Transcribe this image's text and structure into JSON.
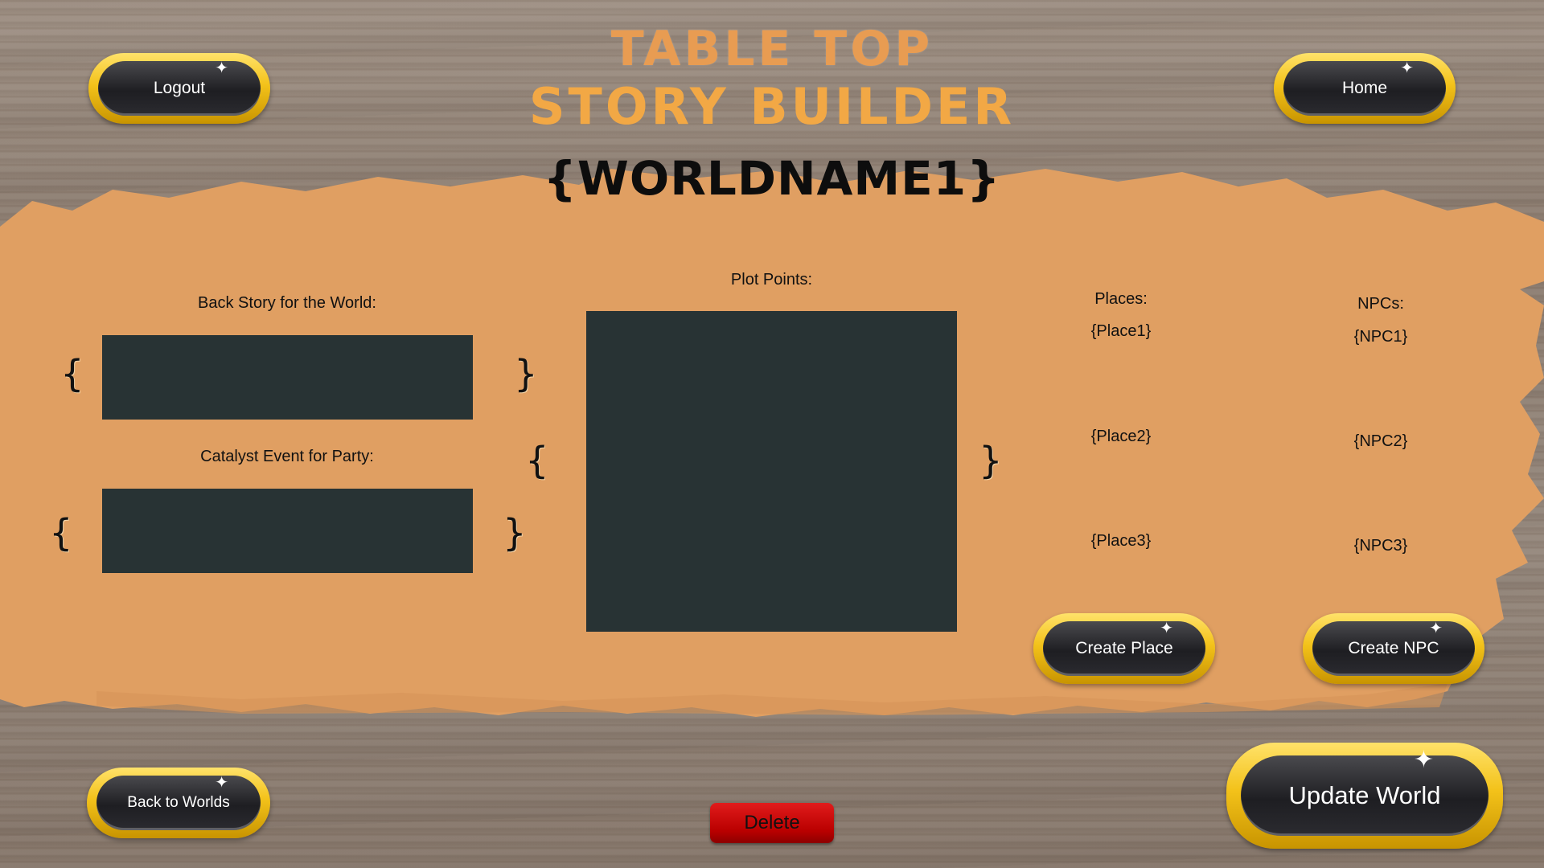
{
  "app": {
    "title_line1": "TABLE TOP",
    "title_line2": "STORY BUILDER",
    "world_name": "{WORLDNAME1}"
  },
  "nav": {
    "logout_label": "Logout",
    "home_label": "Home",
    "back_label": "Back to Worlds",
    "delete_label": "Delete",
    "update_label": "Update World"
  },
  "backstory": {
    "label": "Back Story for the World:",
    "value": ""
  },
  "catalyst": {
    "label": "Catalyst Event for Party:",
    "value": ""
  },
  "plot": {
    "label": "Plot Points:",
    "value": ""
  },
  "places": {
    "label": "Places:",
    "items": [
      "{Place1}",
      "{Place2}",
      "{Place3}"
    ],
    "create_label": "Create Place"
  },
  "npcs": {
    "label": "NPCs:",
    "items": [
      "{NPC1}",
      "{NPC2}",
      "{NPC3}"
    ],
    "create_label": "Create NPC"
  },
  "braces": {
    "open": "{",
    "close": "}"
  },
  "colors": {
    "paint": "#e09f62",
    "box": "#283334",
    "gold": "#f3c21a",
    "delete": "#c60000"
  }
}
